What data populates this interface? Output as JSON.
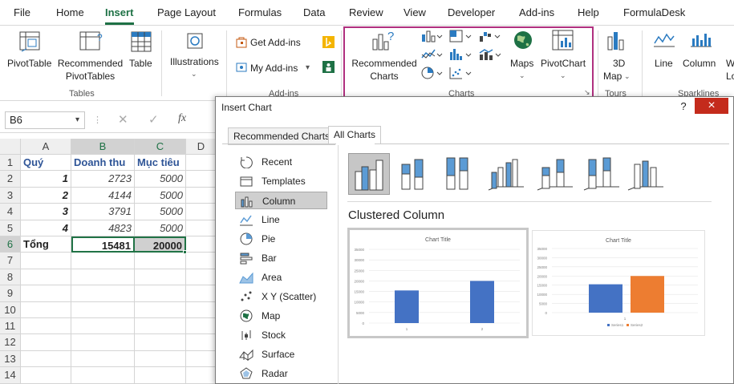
{
  "menu": {
    "tabs": [
      "File",
      "Home",
      "Insert",
      "Page Layout",
      "Formulas",
      "Data",
      "Review",
      "View",
      "Developer",
      "Add-ins",
      "Help",
      "FormulaDesk"
    ]
  },
  "ribbon": {
    "pivottable": "PivotTable",
    "recommended_pivot_1": "Recommended",
    "recommended_pivot_2": "PivotTables",
    "table": "Table",
    "tables_group": "Tables",
    "illustrations": "Illustrations",
    "get_addins": "Get Add-ins",
    "my_addins": "My Add-ins",
    "addins_group": "Add-ins",
    "recommended_charts_1": "Recommended",
    "recommended_charts_2": "Charts",
    "maps": "Maps",
    "pivotchart": "PivotChart",
    "charts_group": "Charts",
    "map3d_1": "3D",
    "map3d_2": "Map",
    "tours_group": "Tours",
    "line": "Line",
    "column": "Column",
    "winloss_1": "W",
    "winloss_2": "Lo",
    "sparklines_group": "Sparklines"
  },
  "formula_bar": {
    "name_box": "B6",
    "fx": "fx"
  },
  "sheet": {
    "columns": [
      "A",
      "B",
      "C",
      "D"
    ],
    "rows": [
      "1",
      "2",
      "3",
      "4",
      "5",
      "6",
      "7",
      "8",
      "9",
      "10",
      "11",
      "12",
      "13",
      "14"
    ],
    "header_row": [
      "Quý",
      "Doanh thu",
      "Mục tiêu"
    ],
    "data": [
      [
        "1",
        "2723",
        "5000"
      ],
      [
        "2",
        "4144",
        "5000"
      ],
      [
        "3",
        "3791",
        "5000"
      ],
      [
        "4",
        "4823",
        "5000"
      ]
    ],
    "total": [
      "Tổng",
      "15481",
      "20000"
    ]
  },
  "dialog": {
    "title": "Insert Chart",
    "help": "?",
    "close": "×",
    "tabs": [
      "Recommended Charts",
      "All Charts"
    ],
    "chart_types": [
      "Recent",
      "Templates",
      "Column",
      "Line",
      "Pie",
      "Bar",
      "Area",
      "X Y (Scatter)",
      "Map",
      "Stock",
      "Surface",
      "Radar"
    ],
    "subtype_title": "Clustered Column",
    "preview1": {
      "title": "Chart Title",
      "yticks": [
        "35000",
        "30000",
        "25000",
        "20000",
        "15000",
        "10000",
        "5000",
        "0"
      ],
      "xlabels": [
        "1",
        "2"
      ],
      "values": [
        15481,
        20000
      ]
    },
    "preview2": {
      "title": "Chart Title",
      "yticks": [
        "35000",
        "30000",
        "25000",
        "20000",
        "15000",
        "10000",
        "5000",
        "0"
      ],
      "xlabel": "1",
      "values": [
        15481,
        20000
      ],
      "legend": [
        "Series1",
        "Series2"
      ]
    },
    "colors": {
      "blue": "#4472c4",
      "orange": "#ed7d31",
      "selected_tab": "#217346"
    }
  }
}
